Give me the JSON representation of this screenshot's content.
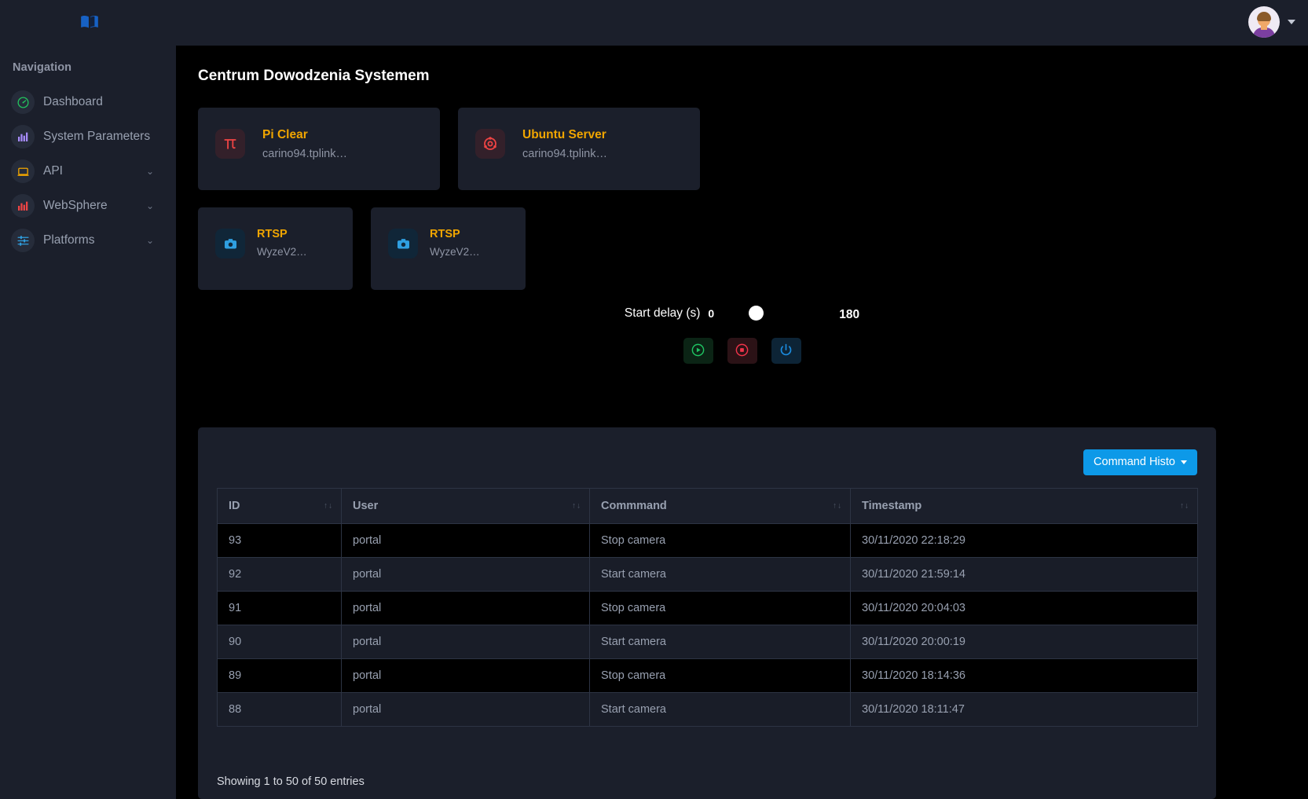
{
  "topbar": {
    "logo_icon": "open-book-icon",
    "logo_color": "#1761c4",
    "avatar_icon": "user-avatar",
    "caret_icon": "chevron-down-icon"
  },
  "sidebar": {
    "heading": "Navigation",
    "items": [
      {
        "label": "Dashboard",
        "icon": "speedometer-icon",
        "icon_color": "#22c55e",
        "expandable": false,
        "chevron": ""
      },
      {
        "label": "System Parameters",
        "icon": "bar-chart-icon",
        "icon_color": "#a78bfa",
        "expandable": false,
        "chevron": ""
      },
      {
        "label": "API",
        "icon": "laptop-icon",
        "icon_color": "#f0a500",
        "expandable": true,
        "chevron": "⌄"
      },
      {
        "label": "WebSphere",
        "icon": "bar-chart-icon",
        "icon_color": "#ef4444",
        "expandable": true,
        "chevron": "⌄"
      },
      {
        "label": "Platforms",
        "icon": "sliders-icon",
        "icon_color": "#2f9fe0",
        "expandable": true,
        "chevron": "⌄"
      }
    ]
  },
  "main": {
    "title": "Centrum Dowodzenia Systemem",
    "devices": [
      {
        "name": "Pi Clear",
        "host": "carino94.tplink…",
        "icon": "raspberry-pi-icon",
        "icon_color": "#ef4444",
        "icon_bg": "red"
      },
      {
        "name": "Ubuntu Server",
        "host": "carino94.tplink…",
        "icon": "ubuntu-icon",
        "icon_color": "#ef4444",
        "icon_bg": "red"
      },
      {
        "name": "RTSP",
        "host": "WyzeV2…",
        "icon": "camera-icon",
        "icon_color": "#2f9fe0",
        "icon_bg": "blue"
      },
      {
        "name": "RTSP",
        "host": "WyzeV2…",
        "icon": "camera-icon",
        "icon_color": "#2f9fe0",
        "icon_bg": "blue"
      }
    ],
    "delay": {
      "label": "Start delay (s)",
      "min": "0",
      "max": "180",
      "value": 0
    },
    "controls": [
      {
        "name": "start-button",
        "icon": "circle-play-icon",
        "color": "#1fc462"
      },
      {
        "name": "stop-button",
        "icon": "circle-stop-icon",
        "color": "#f0344a"
      },
      {
        "name": "power-button",
        "icon": "power-icon",
        "color": "#1b8ce0"
      }
    ]
  },
  "panel": {
    "history_button": "Command Histo",
    "columns": [
      "ID",
      "User",
      "Commmand",
      "Timestamp"
    ],
    "rows": [
      {
        "id": "93",
        "user": "portal",
        "command": "Stop camera",
        "timestamp": "30/11/2020 22:18:29"
      },
      {
        "id": "92",
        "user": "portal",
        "command": "Start camera",
        "timestamp": "30/11/2020 21:59:14"
      },
      {
        "id": "91",
        "user": "portal",
        "command": "Stop camera",
        "timestamp": "30/11/2020 20:04:03"
      },
      {
        "id": "90",
        "user": "portal",
        "command": "Start camera",
        "timestamp": "30/11/2020 20:00:19"
      },
      {
        "id": "89",
        "user": "portal",
        "command": "Stop camera",
        "timestamp": "30/11/2020 18:14:36"
      },
      {
        "id": "88",
        "user": "portal",
        "command": "Start camera",
        "timestamp": "30/11/2020 18:11:47"
      }
    ],
    "entries_info": "Showing 1 to 50 of 50 entries",
    "sort_indicator": "↑↓"
  },
  "colors": {
    "accent_blue": "#0d99e8",
    "card_title": "#f0a500",
    "panel_bg": "#1b1f2b",
    "page_bg": "#000000"
  }
}
